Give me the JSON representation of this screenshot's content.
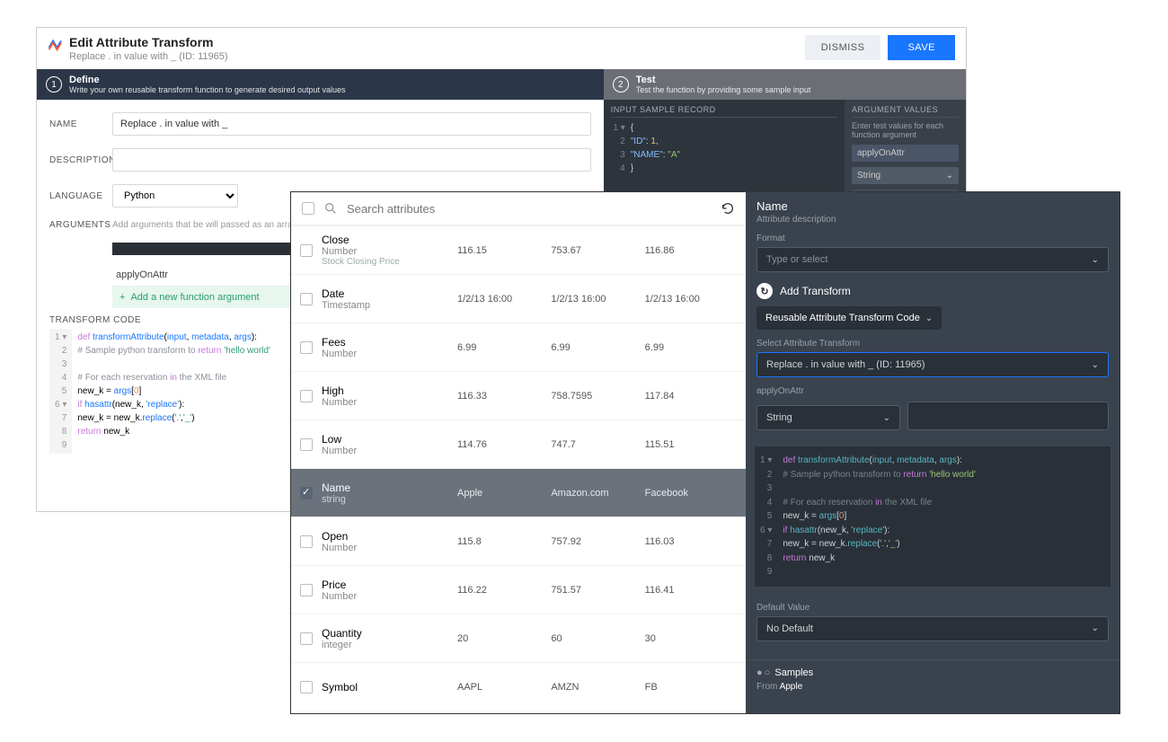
{
  "modal": {
    "title": "Edit Attribute Transform",
    "subtitle": "Replace . in value with _ (ID: 11965)",
    "dismiss": "DISMISS",
    "save": "SAVE",
    "step1": {
      "num": "1",
      "title": "Define",
      "sub": "Write your own reusable transform function to generate desired output values"
    },
    "step2": {
      "num": "2",
      "title": "Test",
      "sub": "Test the function by providing some sample input"
    },
    "form": {
      "name_lbl": "NAME",
      "name_val": "Replace . in value with _",
      "desc_lbl": "DESCRIPTION",
      "desc_val": "",
      "lang_lbl": "LANGUAGE",
      "lang_val": "Python",
      "args_lbl": "ARGUMENTS",
      "args_hint": "Add arguments that be will passed as an array to the transform function",
      "arg0": "applyOnAttr",
      "add_arg": "Add a new function argument",
      "code_hdr": "TRANSFORM CODE"
    },
    "code_lines": [
      "def transformAttribute(input, metadata, args):",
      "    # Sample python transform to return 'hello world'",
      "",
      "    # For each reservation in the XML file",
      "    new_k = args[0]",
      "    if hasattr(new_k, 'replace'):",
      "        new_k = new_k.replace('.','_')",
      "    return new_k",
      ""
    ],
    "test": {
      "input_hdr": "INPUT SAMPLE RECORD",
      "json_lines": [
        "{",
        "  \"ID\": 1,",
        "  \"NAME\": \"A\"",
        "}"
      ],
      "argvals_hdr": "ARGUMENT VALUES",
      "argvals_sub": "Enter test values for each function argument",
      "arg_name": "applyOnAttr",
      "arg_type": "String"
    }
  },
  "front": {
    "search_ph": "Search attributes",
    "rows": [
      {
        "name": "Close",
        "type": "Number",
        "desc": "Stock Closing Price",
        "c1": "116.15",
        "c2": "753.67",
        "c3": "116.86",
        "sel": false
      },
      {
        "name": "Date",
        "type": "Timestamp",
        "desc": "",
        "c1": "1/2/13 16:00",
        "c2": "1/2/13 16:00",
        "c3": "1/2/13 16:00",
        "sel": false
      },
      {
        "name": "Fees",
        "type": "Number",
        "desc": "",
        "c1": "6.99",
        "c2": "6.99",
        "c3": "6.99",
        "sel": false
      },
      {
        "name": "High",
        "type": "Number",
        "desc": "",
        "c1": "116.33",
        "c2": "758.7595",
        "c3": "117.84",
        "sel": false
      },
      {
        "name": "Low",
        "type": "Number",
        "desc": "",
        "c1": "114.76",
        "c2": "747.7",
        "c3": "115.51",
        "sel": false
      },
      {
        "name": "Name",
        "type": "string",
        "desc": "",
        "c1": "Apple",
        "c2": "Amazon.com",
        "c3": "Facebook",
        "sel": true
      },
      {
        "name": "Open",
        "type": "Number",
        "desc": "",
        "c1": "115.8",
        "c2": "757.92",
        "c3": "116.03",
        "sel": false
      },
      {
        "name": "Price",
        "type": "Number",
        "desc": "",
        "c1": "116.22",
        "c2": "751.57",
        "c3": "116.41",
        "sel": false
      },
      {
        "name": "Quantity",
        "type": "integer",
        "desc": "",
        "c1": "20",
        "c2": "60",
        "c3": "30",
        "sel": false
      },
      {
        "name": "Symbol",
        "type": "",
        "desc": "",
        "c1": "AAPL",
        "c2": "AMZN",
        "c3": "FB",
        "sel": false
      }
    ],
    "right": {
      "title": "Name",
      "sub": "Attribute description",
      "format_lbl": "Format",
      "format_ph": "Type or select",
      "add_transform": "Add Transform",
      "transform_type": "Reusable Attribute Transform Code",
      "select_lbl": "Select Attribute Transform",
      "selected": "Replace . in value with _ (ID: 11965)",
      "arg_name": "applyOnAttr",
      "arg_type": "String",
      "default_lbl": "Default Value",
      "default_val": "No Default",
      "samples_lbl": "Samples",
      "samples_from": "From",
      "samples_src": "Apple"
    }
  }
}
